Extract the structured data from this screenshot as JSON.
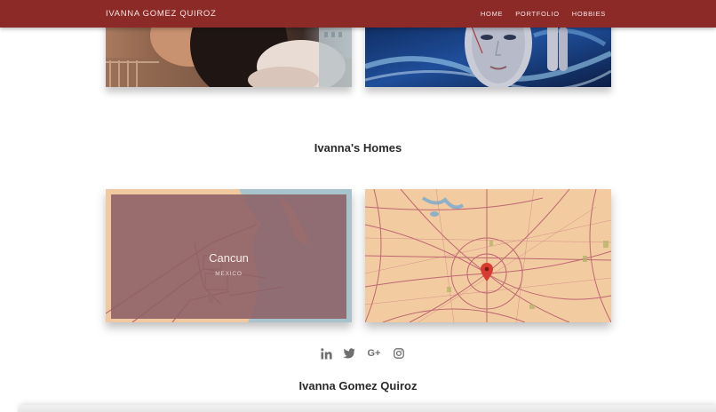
{
  "navbar": {
    "brand": "IVANNA GOMEZ QUIROZ",
    "links": [
      "HOME",
      "PORTFOLIO",
      "HOBBIES"
    ]
  },
  "homes": {
    "title": "Ivanna's Homes",
    "cards": [
      {
        "city": "Cancun",
        "country": "MEXICO"
      }
    ]
  },
  "social": {
    "icons": [
      "linkedin-icon",
      "twitter-icon",
      "google-plus-icon",
      "instagram-icon"
    ],
    "google_plus_label": "G+"
  },
  "footer": {
    "name": "Ivanna Gomez Quiroz"
  },
  "colors": {
    "navbar": "#8c2a27",
    "map_land": "#f0c9a0",
    "map_water": "#a9c3cc",
    "map_roads": "#b8576a",
    "overlay": "#8c6066",
    "icon_gray": "#6f6f6f"
  }
}
